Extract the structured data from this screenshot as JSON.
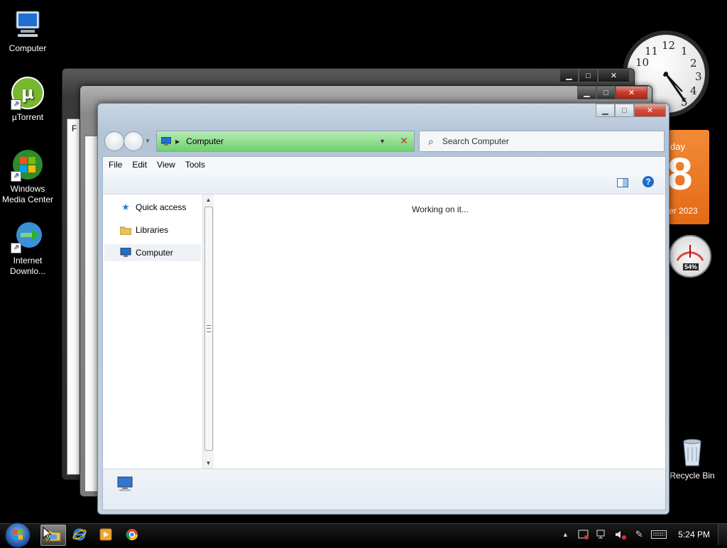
{
  "desktop": {
    "icons": [
      {
        "label": "Computer"
      },
      {
        "label": "µTorrent"
      },
      {
        "label": "Windows Media Center"
      },
      {
        "label": "Internet Downlo..."
      },
      {
        "label": "Recycle Bin"
      }
    ]
  },
  "window": {
    "address": "Computer",
    "search_placeholder": "Search Computer",
    "menu": [
      "File",
      "Edit",
      "View",
      "Tools"
    ],
    "nav_items": [
      "Quick access",
      "Libraries",
      "Computer"
    ],
    "status_message": "Working on it...",
    "back_window_fragment": "F"
  },
  "gadgets": {
    "clock_numbers": [
      "12",
      "1",
      "2",
      "3",
      "4",
      "5",
      "10",
      "11"
    ],
    "calendar_day_fragment": "day",
    "calendar_date": "8",
    "calendar_year_fragment": "er 2023",
    "meter_percent": "54%"
  },
  "taskbar": {
    "time": "5:24 PM"
  },
  "colors": {
    "address_bar": "#6fd06d",
    "calendar": "#e36a17",
    "close_button": "#c43b2a"
  }
}
